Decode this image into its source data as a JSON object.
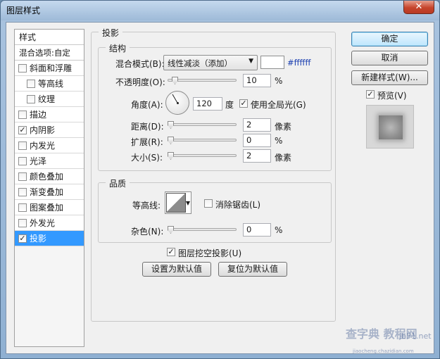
{
  "window": {
    "title": "图层样式",
    "close": "✕"
  },
  "style_list": {
    "header": "样式",
    "blend_options": "混合选项:自定",
    "items": [
      {
        "label": "斜面和浮雕",
        "checked": false,
        "sub": false,
        "active": false
      },
      {
        "label": "等高线",
        "checked": false,
        "sub": true,
        "active": false
      },
      {
        "label": "纹理",
        "checked": false,
        "sub": true,
        "active": false
      },
      {
        "label": "描边",
        "checked": false,
        "sub": false,
        "active": false
      },
      {
        "label": "内阴影",
        "checked": true,
        "sub": false,
        "active": false
      },
      {
        "label": "内发光",
        "checked": false,
        "sub": false,
        "active": false
      },
      {
        "label": "光泽",
        "checked": false,
        "sub": false,
        "active": false
      },
      {
        "label": "颜色叠加",
        "checked": false,
        "sub": false,
        "active": false
      },
      {
        "label": "渐变叠加",
        "checked": false,
        "sub": false,
        "active": false
      },
      {
        "label": "图案叠加",
        "checked": false,
        "sub": false,
        "active": false
      },
      {
        "label": "外发光",
        "checked": false,
        "sub": false,
        "active": false
      },
      {
        "label": "投影",
        "checked": true,
        "sub": false,
        "active": true
      }
    ]
  },
  "shadow": {
    "title": "投影",
    "structure": {
      "title": "结构",
      "blend_mode_label": "混合模式(B):",
      "blend_mode_value": "线性减淡（添加）",
      "color_hex": "#ffffff",
      "opacity_label": "不透明度(O):",
      "opacity_value": "10",
      "opacity_unit": "%",
      "angle_label": "角度(A):",
      "angle_value": "120",
      "angle_unit": "度",
      "global_light_label": "使用全局光(G)",
      "global_light_checked": true,
      "distance_label": "距离(D):",
      "distance_value": "2",
      "distance_unit": "像素",
      "spread_label": "扩展(R):",
      "spread_value": "0",
      "spread_unit": "%",
      "size_label": "大小(S):",
      "size_value": "2",
      "size_unit": "像素"
    },
    "quality": {
      "title": "品质",
      "contour_label": "等高线:",
      "anti_alias_label": "消除锯齿(L)",
      "anti_alias_checked": false,
      "noise_label": "杂色(N):",
      "noise_value": "0",
      "noise_unit": "%"
    },
    "knockout_label": "图层挖空投影(U)",
    "knockout_checked": true,
    "set_default": "设置为默认值",
    "reset_default": "复位为默认值"
  },
  "buttons": {
    "ok": "确定",
    "cancel": "取消",
    "new_style": "新建样式(W)...",
    "preview_label": "预览(V)",
    "preview_checked": true
  },
  "watermark": {
    "line1": "查字典 教程网",
    "line2": "jb51.net",
    "line3": "jiaocheng.chazidian.com"
  }
}
